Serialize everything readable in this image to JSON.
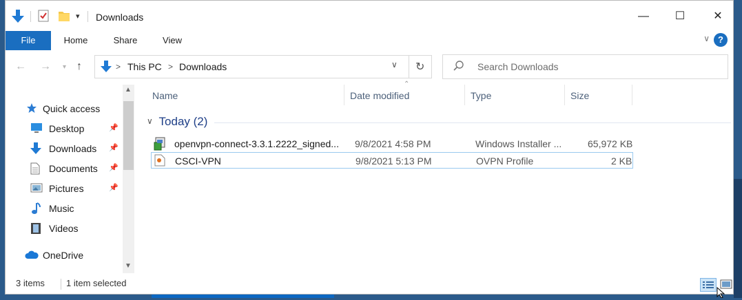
{
  "window": {
    "title": "Downloads",
    "controls": {
      "minimize": "—",
      "maximize": "☐",
      "close": "✕"
    }
  },
  "ribbon": {
    "tabs": [
      "File",
      "Home",
      "Share",
      "View"
    ],
    "help": "?",
    "expand": "∨"
  },
  "address": {
    "segments": [
      "This PC",
      "Downloads"
    ],
    "search_placeholder": "Search Downloads"
  },
  "nav": {
    "items": [
      {
        "label": "Quick access",
        "icon": "star-icon",
        "pinned": false
      },
      {
        "label": "Desktop",
        "icon": "desktop-icon",
        "pinned": true
      },
      {
        "label": "Downloads",
        "icon": "download-arrow-icon",
        "pinned": true
      },
      {
        "label": "Documents",
        "icon": "document-icon",
        "pinned": true
      },
      {
        "label": "Pictures",
        "icon": "pictures-icon",
        "pinned": true
      },
      {
        "label": "Music",
        "icon": "music-icon",
        "pinned": false
      },
      {
        "label": "Videos",
        "icon": "videos-icon",
        "pinned": false
      },
      {
        "label": "OneDrive",
        "icon": "cloud-icon",
        "pinned": false
      }
    ]
  },
  "columns": {
    "name": "Name",
    "date": "Date modified",
    "type": "Type",
    "size": "Size"
  },
  "group": {
    "label": "Today (2)"
  },
  "files": [
    {
      "name": "openvpn-connect-3.3.1.2222_signed...",
      "date": "9/8/2021 4:58 PM",
      "type": "Windows Installer ...",
      "size": "65,972 KB",
      "icon": "installer-icon",
      "selected": false
    },
    {
      "name": "CSCI-VPN",
      "date": "9/8/2021 5:13 PM",
      "type": "OVPN Profile",
      "size": "2 KB",
      "icon": "ovpn-file-icon",
      "selected": true
    }
  ],
  "status": {
    "count": "3 items",
    "selection": "1 item selected"
  },
  "colors": {
    "accent": "#1a6ec0",
    "group_text": "#1e3f87",
    "selection_border": "#99c9ef"
  }
}
